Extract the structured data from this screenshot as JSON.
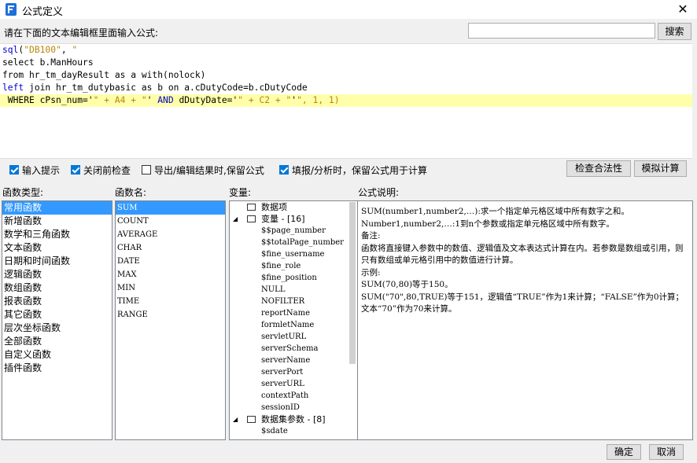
{
  "window": {
    "title": "公式定义",
    "close_glyph": "✕"
  },
  "prompt": "请在下面的文本编辑框里面输入公式:",
  "search": {
    "value": "",
    "button": "搜索"
  },
  "code_lines": [
    [
      {
        "t": "sql",
        "c": "kw"
      },
      {
        "t": "(",
        "c": "plain"
      },
      {
        "t": "\"DB100\"",
        "c": "str"
      },
      {
        "t": ", ",
        "c": "plain"
      },
      {
        "t": "\"",
        "c": "str"
      }
    ],
    [
      {
        "t": "select b.ManHours",
        "c": "plain"
      }
    ],
    [
      {
        "t": "from hr_tm_dayResult as a with(nolock)",
        "c": "plain"
      }
    ],
    [
      {
        "t": "left",
        "c": "kw"
      },
      {
        "t": " join hr_tm_dutybasic as b on a.cDutyCode=b.cDutyCode",
        "c": "plain"
      }
    ],
    [
      {
        "t": " WHERE cPsn_num='",
        "c": "plain"
      },
      {
        "t": "\" + A4 + \"",
        "c": "str"
      },
      {
        "t": "' ",
        "c": "plain"
      },
      {
        "t": "AND",
        "c": "kw"
      },
      {
        "t": " dDutyDate='",
        "c": "plain"
      },
      {
        "t": "\" + C2 + \"",
        "c": "str"
      },
      {
        "t": "'",
        "c": "plain"
      },
      {
        "t": "\"",
        "c": "str"
      },
      {
        "t": ", 1, 1)",
        "c": "num"
      }
    ]
  ],
  "options": [
    {
      "label": "输入提示",
      "checked": true
    },
    {
      "label": "关闭前检查",
      "checked": true
    },
    {
      "label": "导出/编辑结果时,保留公式",
      "checked": false
    },
    {
      "label": "填报/分析时，保留公式用于计算",
      "checked": true
    }
  ],
  "buttons": {
    "validate": "检查合法性",
    "simulate": "模拟计算",
    "ok": "确定",
    "cancel": "取消"
  },
  "sections": {
    "func_type": "函数类型:",
    "func_name": "函数名:",
    "variables": "变量:",
    "description": "公式说明:"
  },
  "func_types": [
    "常用函数",
    "新增函数",
    "数学和三角函数",
    "文本函数",
    "日期和时间函数",
    "逻辑函数",
    "数组函数",
    "报表函数",
    "其它函数",
    "层次坐标函数",
    "全部函数",
    "自定义函数",
    "插件函数"
  ],
  "func_names": [
    "SUM",
    "COUNT",
    "AVERAGE",
    "CHAR",
    "DATE",
    "MAX",
    "MIN",
    "TIME",
    "RANGE"
  ],
  "var_tree": [
    {
      "label": "数据项",
      "level": 0,
      "icon": "dataitem-icon"
    },
    {
      "label": "变量 - [16]",
      "level": 0,
      "icon": "variable-icon",
      "expanded": true
    },
    {
      "label": "$$page_number",
      "level": 1
    },
    {
      "label": "$$totalPage_number",
      "level": 1
    },
    {
      "label": "$fine_username",
      "level": 1
    },
    {
      "label": "$fine_role",
      "level": 1
    },
    {
      "label": "$fine_position",
      "level": 1
    },
    {
      "label": "NULL",
      "level": 1
    },
    {
      "label": "NOFILTER",
      "level": 1
    },
    {
      "label": "reportName",
      "level": 1
    },
    {
      "label": "formletName",
      "level": 1
    },
    {
      "label": "servletURL",
      "level": 1
    },
    {
      "label": "serverSchema",
      "level": 1
    },
    {
      "label": "serverName",
      "level": 1
    },
    {
      "label": "serverPort",
      "level": 1
    },
    {
      "label": "serverURL",
      "level": 1
    },
    {
      "label": "contextPath",
      "level": 1
    },
    {
      "label": "sessionID",
      "level": 1
    },
    {
      "label": "数据集参数 - [8]",
      "level": 0,
      "icon": "dataset-param-icon",
      "expanded": true
    },
    {
      "label": "$sdate",
      "level": 1
    }
  ],
  "description_lines": [
    "SUM(number1,number2,…):求一个指定单元格区域中所有数字之和。",
    "Number1,number2,…:1到n个参数或指定单元格区域中所有数字。",
    "备注:",
    "函数将直接键入参数中的数值、逻辑值及文本表达式计算在内。若参数是数组或引用，则只有数组或单元格引用中的数值进行计算。",
    "示例:",
    "SUM(70,80)等于150。",
    "SUM(\"70\",80,TRUE)等于151，逻辑值“TRUE”作为1来计算；“FALSE”作为0计算；文本“70”作为70来计算。"
  ]
}
